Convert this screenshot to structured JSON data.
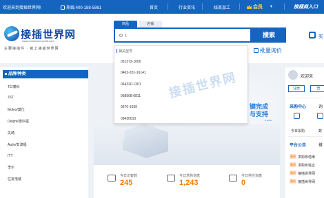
{
  "topbar": {
    "welcome": "欢迎来到接插世界网!",
    "phone": "热线:400-188-5861",
    "nav": [
      "首页",
      "行业资讯",
      "线束加工"
    ],
    "vip": "会员",
    "join": "接插商入口"
  },
  "header": {
    "logo_text": "接插世界网",
    "logo_url": "www.connector-world.com",
    "slogan": "主要接插件 · 就上接插世界网",
    "search_tabs": [
      "商品",
      "店铺"
    ],
    "search_value": "1",
    "search_button": "搜索",
    "quote_link": "批量询价",
    "right_label": "实"
  },
  "dropdown": {
    "header": "相关型号",
    "items": [
      "031372-1000",
      "0462-201-16141",
      "064320-1301",
      "068508-0811",
      "0670-1039",
      "09430010"
    ]
  },
  "sidebar": {
    "header": "品牌/种类",
    "items": [
      "TE/泰科",
      "JST",
      "Molex/莫仕",
      "Delphi/德尔福",
      "矢崎",
      "Aptiv/安波福",
      "ITT",
      "李尔",
      "住友电装"
    ]
  },
  "banner": {
    "slogan": "键完成\n与支持",
    "slogan_sub": "& Jesus"
  },
  "watermark": "接插世界网",
  "stats": [
    {
      "label": "今日访客数",
      "value": "245"
    },
    {
      "label": "今日求购询盘",
      "value": "1,243"
    },
    {
      "label": "今日供应询盘",
      "value": "0"
    }
  ],
  "rpanel": {
    "welcome": "欢迎来",
    "login": "注册",
    "register": "登",
    "section1": "采购中心",
    "section1b": "询",
    "icons": [
      "今日采购",
      "数"
    ],
    "section2": "平台公告",
    "section2b": "推",
    "tags": [
      "最新",
      "最新",
      "最新",
      "最新"
    ],
    "announcements": [
      "求购布塔维",
      "求购布塔正",
      "接插世界网",
      "接插世界网"
    ]
  },
  "colors": {
    "brand_blue": "#1565c0",
    "accent_orange": "#f57c00"
  }
}
